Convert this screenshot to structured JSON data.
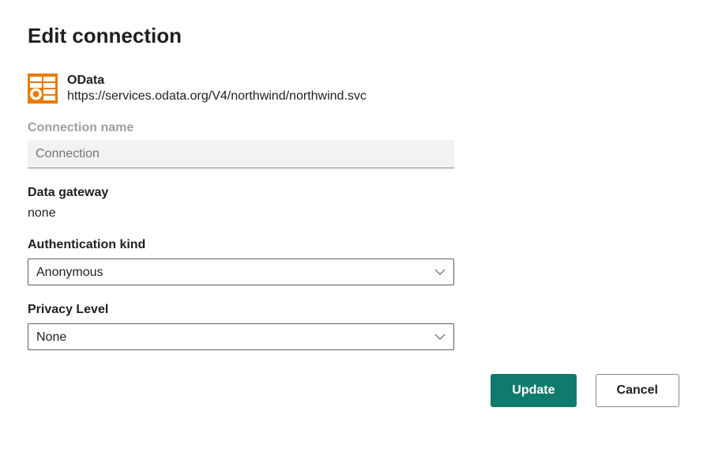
{
  "title": "Edit connection",
  "connection": {
    "type_label": "OData",
    "url": "https://services.odata.org/V4/northwind/northwind.svc"
  },
  "fields": {
    "connection_name": {
      "label": "Connection name",
      "placeholder": "Connection",
      "value": ""
    },
    "data_gateway": {
      "label": "Data gateway",
      "value": "none"
    },
    "authentication_kind": {
      "label": "Authentication kind",
      "selected": "Anonymous"
    },
    "privacy_level": {
      "label": "Privacy Level",
      "selected": "None"
    }
  },
  "buttons": {
    "update": "Update",
    "cancel": "Cancel"
  }
}
